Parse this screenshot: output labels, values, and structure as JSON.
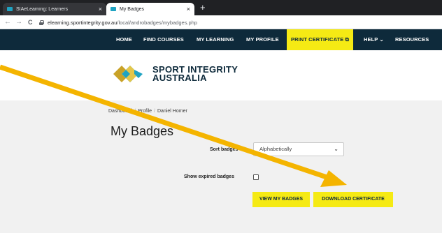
{
  "browser": {
    "tabs": [
      {
        "title": "SIAeLearning: Learners",
        "close": "×"
      },
      {
        "title": "My Badges",
        "close": "×"
      }
    ],
    "new_tab": "+",
    "nav": {
      "back": "←",
      "forward": "→",
      "reload": "C"
    },
    "url_host": "elearning.sportintegrity.gov.au",
    "url_path": "/local/androbadges/mybadges.php"
  },
  "site_nav": {
    "home": "HOME",
    "find_courses": "FIND COURSES",
    "my_learning": "MY LEARNING",
    "my_profile": "MY PROFILE",
    "print_certificate": "PRINT CERTIFICATE ⧉",
    "help": "HELP ⌄",
    "resources": "RESOURCES"
  },
  "logo": {
    "line1": "SPORT INTEGRITY",
    "line2": "AUSTRALIA"
  },
  "breadcrumb": [
    "Dashboard",
    "Profile",
    "Daniel Homer"
  ],
  "page_title": "My Badges",
  "sort": {
    "label": "Sort badges",
    "selected": "Alphabetically"
  },
  "expired": {
    "label": "Show expired badges",
    "checked": false
  },
  "buttons": {
    "view": "VIEW MY BADGES",
    "download": "DOWNLOAD CERTIFICATE"
  },
  "colors": {
    "nav_bg": "#0e2a3b",
    "accent_yellow": "#f5ea14",
    "annotation_arrow": "#f4b400",
    "logo_teal": "#1fa3c2",
    "logo_gold": "#c9a227"
  }
}
